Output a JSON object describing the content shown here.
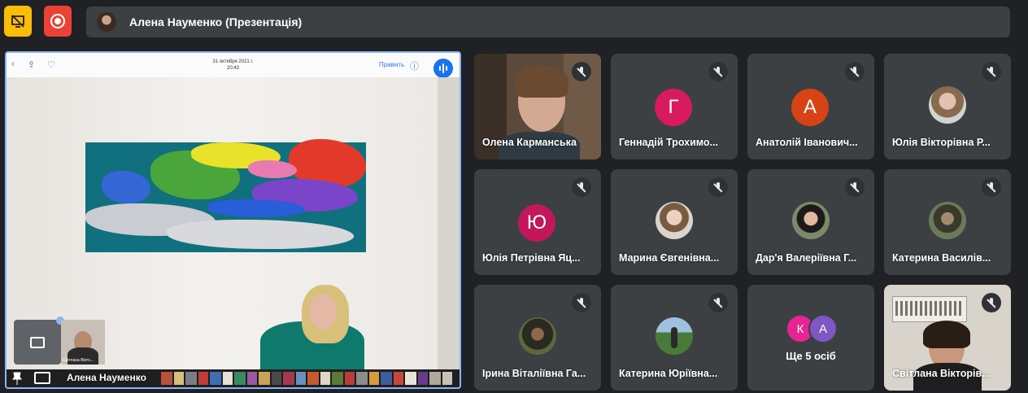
{
  "topbar": {
    "presenter_label": "Алена Науменко (Презентація)"
  },
  "presentation": {
    "photo_date": "31 октября 2021 г.",
    "photo_time": "20:43",
    "edit_label": "Править",
    "presenter_name": "Алена Науменко",
    "self_view_name": "Світлана Вікто..."
  },
  "participants": [
    {
      "name": "Олена Карманська",
      "avatar_type": "video"
    },
    {
      "name": "Геннадій Трохимо...",
      "avatar_type": "letter",
      "letter": "Г",
      "color": "#d81b60"
    },
    {
      "name": "Анатолій Іванович...",
      "avatar_type": "letter",
      "letter": "А",
      "color": "#d84315"
    },
    {
      "name": "Юлія Вікторівна Р...",
      "avatar_type": "photo"
    },
    {
      "name": "Юлія Петрівна Яц...",
      "avatar_type": "letter",
      "letter": "Ю",
      "color": "#c2185b"
    },
    {
      "name": "Марина Євгенівна...",
      "avatar_type": "photo"
    },
    {
      "name": "Дар'я Валеріївна Г...",
      "avatar_type": "photo"
    },
    {
      "name": "Катерина Василів...",
      "avatar_type": "photo"
    },
    {
      "name": "Ірина Віталіївна Га...",
      "avatar_type": "photo"
    },
    {
      "name": "Катерина Юріївна...",
      "avatar_type": "photo"
    },
    {
      "name": "Світлана Вікторів...",
      "avatar_type": "video"
    }
  ],
  "more_tile": {
    "label": "Ще 5 осіб",
    "avatars": [
      {
        "letter": "К",
        "color": "#e52592"
      },
      {
        "letter": "А",
        "color": "#7e57c2"
      }
    ]
  },
  "colors": {
    "background": "#202124",
    "tile": "#3c4043",
    "presentation_border": "#8ab4f8",
    "record": "#ea4335",
    "hide_button": "#fbbc04"
  }
}
